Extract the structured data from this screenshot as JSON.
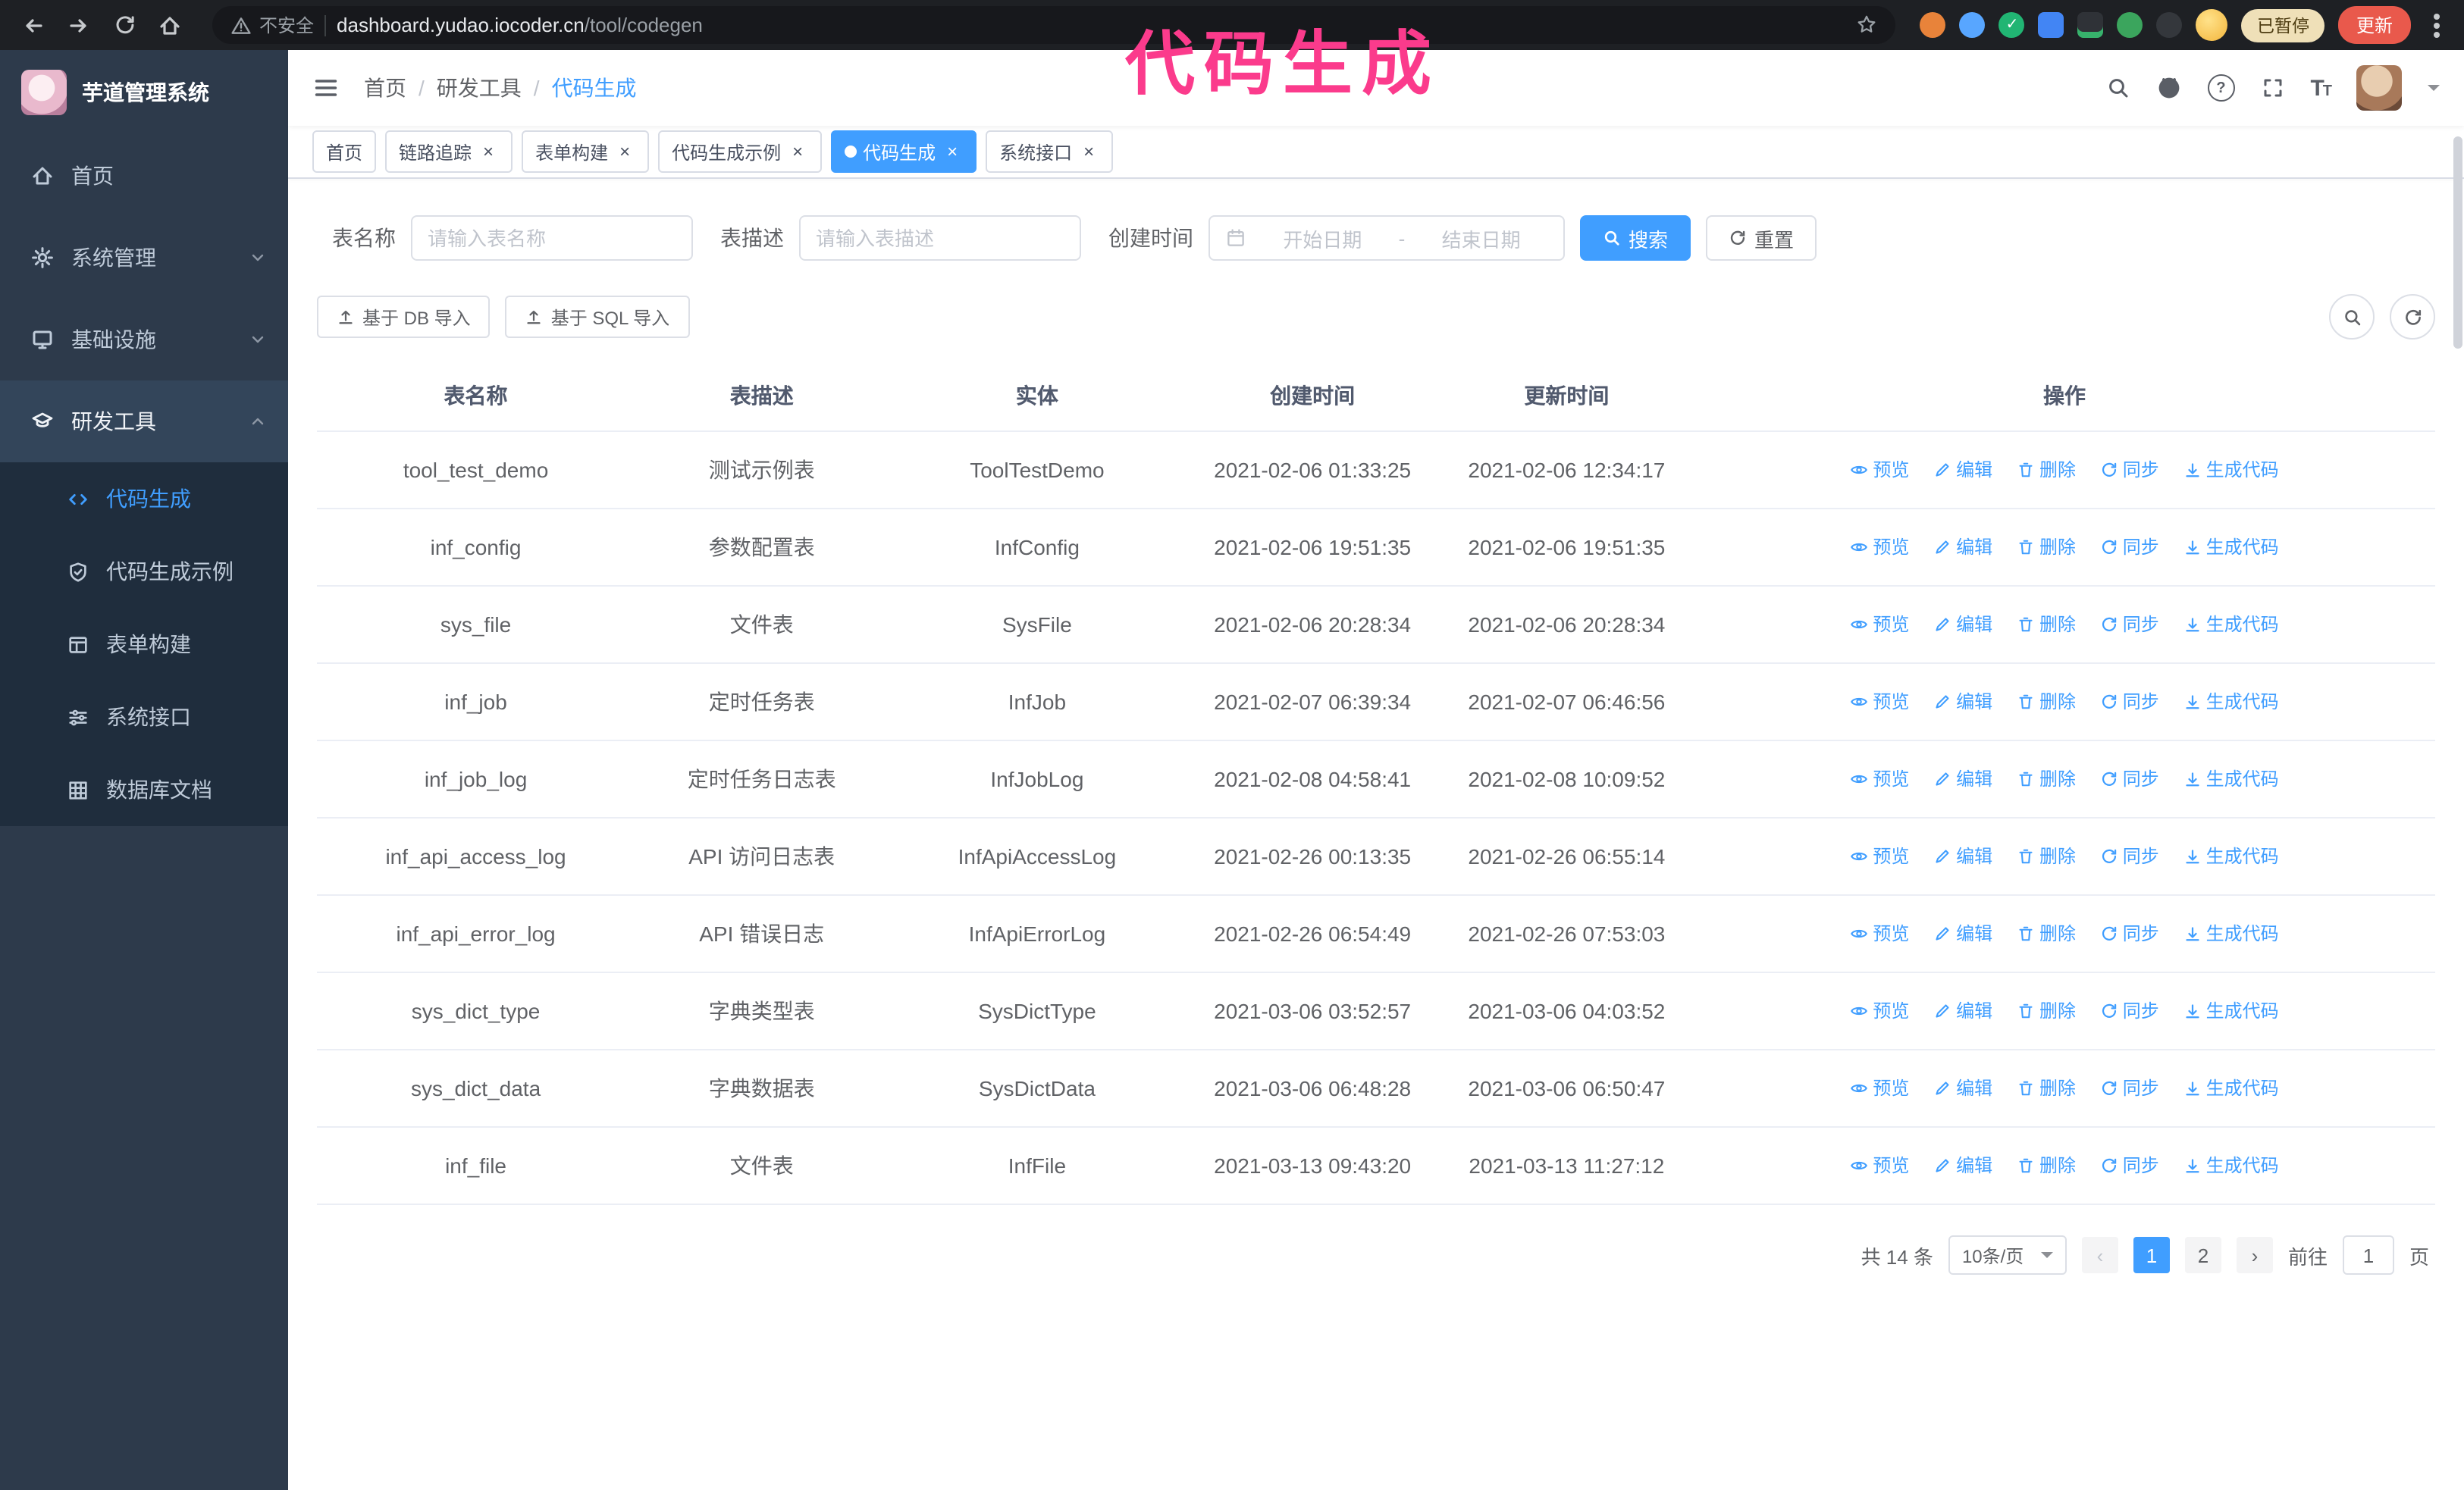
{
  "browser": {
    "security_warning": "不安全",
    "url_host": "dashboard.yudao.iocoder.cn",
    "url_path": "/tool/codegen",
    "paused_badge": "已暂停",
    "update_button": "更新"
  },
  "annotation": {
    "text": "代码生成"
  },
  "colors": {
    "accent": "#409eff",
    "sidebar_bg": "#2d3a4b",
    "submenu_bg": "#1f2d3d",
    "annotation": "#fb3b8c",
    "update_button_bg": "#e9594c",
    "paused_badge_bg": "#efe0b8"
  },
  "sidebar": {
    "logo_title": "芋道管理系统",
    "items": [
      {
        "label": "首页"
      },
      {
        "label": "系统管理"
      },
      {
        "label": "基础设施"
      },
      {
        "label": "研发工具"
      }
    ],
    "subitems": [
      {
        "label": "代码生成",
        "active": true
      },
      {
        "label": "代码生成示例"
      },
      {
        "label": "表单构建"
      },
      {
        "label": "系统接口"
      },
      {
        "label": "数据库文档"
      }
    ]
  },
  "header": {
    "breadcrumb": [
      {
        "label": "首页"
      },
      {
        "label": "研发工具"
      },
      {
        "label": "代码生成"
      }
    ]
  },
  "tabs": [
    {
      "label": "首页",
      "closable": false,
      "active": false
    },
    {
      "label": "链路追踪",
      "closable": true,
      "active": false
    },
    {
      "label": "表单构建",
      "closable": true,
      "active": false
    },
    {
      "label": "代码生成示例",
      "closable": true,
      "active": false
    },
    {
      "label": "代码生成",
      "closable": true,
      "active": true
    },
    {
      "label": "系统接口",
      "closable": true,
      "active": false
    }
  ],
  "filters": {
    "table_name_label": "表名称",
    "table_name_placeholder": "请输入表名称",
    "table_desc_label": "表描述",
    "table_desc_placeholder": "请输入表描述",
    "create_time_label": "创建时间",
    "date_start_placeholder": "开始日期",
    "date_separator": "-",
    "date_end_placeholder": "结束日期",
    "search_button": "搜索",
    "reset_button": "重置"
  },
  "toolbar": {
    "import_db": "基于 DB 导入",
    "import_sql": "基于 SQL 导入"
  },
  "table": {
    "columns": [
      "表名称",
      "表描述",
      "实体",
      "创建时间",
      "更新时间",
      "操作"
    ],
    "actions": [
      "预览",
      "编辑",
      "删除",
      "同步",
      "生成代码"
    ],
    "rows": [
      {
        "name": "tool_test_demo",
        "desc": "测试示例表",
        "entity": "ToolTestDemo",
        "created": "2021-02-06 01:33:25",
        "updated": "2021-02-06 12:34:17"
      },
      {
        "name": "inf_config",
        "desc": "参数配置表",
        "entity": "InfConfig",
        "created": "2021-02-06 19:51:35",
        "updated": "2021-02-06 19:51:35"
      },
      {
        "name": "sys_file",
        "desc": "文件表",
        "entity": "SysFile",
        "created": "2021-02-06 20:28:34",
        "updated": "2021-02-06 20:28:34"
      },
      {
        "name": "inf_job",
        "desc": "定时任务表",
        "entity": "InfJob",
        "created": "2021-02-07 06:39:34",
        "updated": "2021-02-07 06:46:56"
      },
      {
        "name": "inf_job_log",
        "desc": "定时任务日志表",
        "entity": "InfJobLog",
        "created": "2021-02-08 04:58:41",
        "updated": "2021-02-08 10:09:52"
      },
      {
        "name": "inf_api_access_log",
        "desc": "API 访问日志表",
        "entity": "InfApiAccessLog",
        "created": "2021-02-26 00:13:35",
        "updated": "2021-02-26 06:55:14"
      },
      {
        "name": "inf_api_error_log",
        "desc": "API 错误日志",
        "entity": "InfApiErrorLog",
        "created": "2021-02-26 06:54:49",
        "updated": "2021-02-26 07:53:03"
      },
      {
        "name": "sys_dict_type",
        "desc": "字典类型表",
        "entity": "SysDictType",
        "created": "2021-03-06 03:52:57",
        "updated": "2021-03-06 04:03:52"
      },
      {
        "name": "sys_dict_data",
        "desc": "字典数据表",
        "entity": "SysDictData",
        "created": "2021-03-06 06:48:28",
        "updated": "2021-03-06 06:50:47"
      },
      {
        "name": "inf_file",
        "desc": "文件表",
        "entity": "InfFile",
        "created": "2021-03-13 09:43:20",
        "updated": "2021-03-13 11:27:12"
      }
    ]
  },
  "pagination": {
    "total": "共 14 条",
    "page_size": "10条/页",
    "pages": [
      "1",
      "2"
    ],
    "goto_label": "前往",
    "goto_value": "1",
    "goto_suffix": "页"
  }
}
